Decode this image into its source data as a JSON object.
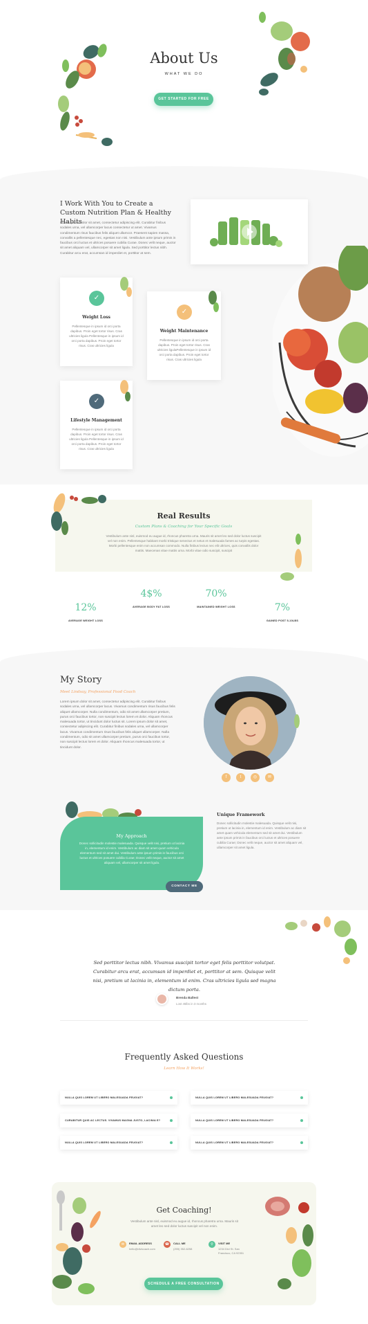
{
  "hero": {
    "title": "About Us",
    "subtitle": "WHAT WE DO",
    "cta": "GET STARTED FOR FREE"
  },
  "plan": {
    "title": "I Work With You to Create a Custom Nutrition Plan & Healthy Habits",
    "body": "Lorem ipsum dolor sit amet, consectetur adipiscing elit. Curabitur finibus sodales urna, vel ullamcorper lacus consectetur ut amet. Vivamus condimentum risus faucibus felis aliquet ullamcor. Praesent sapien massa, convallis a pellentesque nec, egestas non nisi. Vestibulum ante ipsum primis in faucibus orci luctus et ultrices posuere cubilia Curae. Donec velit neque, auctor sit amet aliquam vel, ullamcorper sit amet ligula. Sed porttitor lectus nibh. Curabitur arcu erat, accumsan id imperdiet et, porttitor at sem."
  },
  "services": [
    {
      "title": "Weight Loss",
      "body": "Pellentesque in ipsum id orci porta dapibus. Proin eget tortor risus. Cras ultricies ligula Pellentesque in ipsum id orci porta dapibus. Proin eget tortor risus. Cras ultricies ligula",
      "color": "#5ac59a",
      "icon": "check-icon"
    },
    {
      "title": "Weight Maintenance",
      "body": "Pellentesque in ipsum id orci porta dapibus. Proin eget tortor risus. Cras ultricies ligulaPellentesque in ipsum id orci porta dapibus. Proin eget tortor risus. Cras ultricies ligula",
      "color": "#f4c07a",
      "icon": "check-icon"
    },
    {
      "title": "Lifestyle Management",
      "body": "Pellentesque in ipsum id orci porta dapibus. Proin eget tortor risus. Cras ultricies ligula Pellentesque in ipsum id orci porta dapibus. Proin eget tortor risus. Cras ultricies ligula",
      "color": "#4f6a7a",
      "icon": "check-icon"
    }
  ],
  "results": {
    "title": "Real Results",
    "subtitle": "Custom Plans & Coaching for Your Specific Goals",
    "body": "Vestibulum ante nisl, euismod eu augue id, rhoncus pharetra urna. Mauris sit amet leo sed dolor luctus suscipit vel non enim. Pellentesque habitant morbi tristique senectus et netus et malesuada fames ac turpis egestas. Morbi pellentesque enim non accumsan commodo. Nulla finibus lectus nec elit ultrices, quis convallis dolor mattis. Maecenas vitae mattis urna. Morbi vitae odio suscipit, suscipit",
    "stats": [
      {
        "num": "12%",
        "label": "AVERAGE WEIGHT LOSS"
      },
      {
        "num": "4$%",
        "label": "AVERAGE BODY FAT LOSS"
      },
      {
        "num": "70%",
        "label": "MAINTAINED WEIGHT LOSS"
      },
      {
        "num": "7%",
        "label": "GAINED POST 5-10LBS"
      }
    ]
  },
  "story": {
    "title": "My Story",
    "subtitle": "Meet Lindsay, Professional Food Coach",
    "body": "Lorem ipsum dolor sit amet, consectetur adipiscing elit. Curabitur finibus sodales urna, vel ullamcorper lacus. Vivamus condimentum risus faucibus felis aliquet ullamcorper. Nulla condimentum, odio sit amet ullamcorper pretium, purus orci faucibus tortor, non suscipit lectus lorem et dolor. Aliquam rhoncus malesuada tortor, ut tincidunt dolor luctus sit. Lorem ipsum dolor sit amet, consectetur adipiscing elit. Curabitur finibus sodales urna, vel ullamcorper lacus. Vivamus condimentum risus faucibus felis aliquet ullamcorper. Nulla condimentum, odio sit amet ullamcorper pretium, purus orci faucibus tortor, non suscipit lectus lorem et dolor. Aliquam rhoncus malesuada tortor, ut tincidunt dolor."
  },
  "approach": {
    "title": "My Approach",
    "body": "Donec sollicitudin molestie malesuada. Quisque velit nisi, pretium ut lacinia in, elementum id enim. Vestibulum ac diam sit amet quam vehicula elementum sed sit amet dui. Vestibulum ante ipsum primis in faucibus orci luctus et ultrices posuere cubilia Curae; Donec velit neque, auctor sit amet aliquam vel, ullamcorper sit amet ligula.",
    "cta": "CONTACT ME"
  },
  "framework": {
    "title": "Unique Framework",
    "body": "Donec sollicitudin molestie malesuada. Quisque velit nisi, pretium ut lacinia in, elementum id enim. Vestibulum ac diam sit amet quam vehicula elementum sed sit amet dui. Vestibulum ante ipsum primis in faucibus orci luctus et ultrices posuere cubilia Curae; Donec velit neque, auctor sit amet aliquam vel, ullamcorper sit amet ligula."
  },
  "testimonial": {
    "quote": "Sed porttitor lectus nibh. Vivamus suscipit tortor eget felis porttitor volutpat. Curabitur arcu erat, accumsan id imperdiet et, porttitor at sem. Quisque velit nisi, pretium ut lacinia in, elementum id enim. Cras ultricies ligula sed magna dictum porta.",
    "name": "Brenda Ballest",
    "meta": "Lost 45lbs in 3 months"
  },
  "faq": {
    "title": "Frequently Asked Questions",
    "subtitle": "Learn How It Works!",
    "items": [
      "NULLA QUIS LOREM UT LIBERO MALESUADA FEUGIAT?",
      "NULLA QUIS LOREM UT LIBERO MALESUADA FEUGIAT?",
      "CURABITUR QUIS AC LECTUS. VIVAMUS MAGNA JUSTO, LACINIA E?",
      "NULLA QUIS LOREM UT LIBERO MALESUADA FEUGIAT?",
      "NULLA QUIS LOREM UT LIBERO MALESUADA FEUGIAT?",
      "NULLA QUIS LOREM UT LIBERO MALESUADA FEUGIAT?"
    ]
  },
  "coaching": {
    "title": "Get Coaching!",
    "body": "Vestibulum ante nisl, euismod eu augue id, rhoncus pharetra urna. Mauris sit amet leo sed dolor luctus suscipit vel non enim.",
    "email_label": "EMAIL ADDRESS",
    "email": "hello@divicoach.com",
    "call_label": "CALL ME",
    "phone": "(255) 352-6258",
    "visit_label": "VISIT ME",
    "address": "1234 Divi St. San Francisco, CA 92351",
    "cta": "SCHEDULE A FREE CONSULTATION"
  },
  "colors": {
    "accent": "#5ac59a",
    "orange": "#f4a261",
    "yellow": "#f4c07a",
    "slate": "#4f6a7a"
  }
}
